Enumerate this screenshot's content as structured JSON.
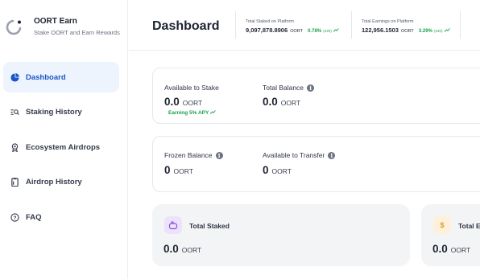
{
  "brand": {
    "name": "OORT Earn",
    "tagline": "Stake OORT and Earn Rewards"
  },
  "sidebar": {
    "items": [
      {
        "label": "Dashboard",
        "icon": "pie-chart-icon",
        "active": true
      },
      {
        "label": "Staking History",
        "icon": "list-search-icon",
        "active": false
      },
      {
        "label": "Ecosystem Airdrops",
        "icon": "medal-icon",
        "active": false
      },
      {
        "label": "Airdrop History",
        "icon": "clipboard-icon",
        "active": false
      },
      {
        "label": "FAQ",
        "icon": "question-circle-icon",
        "active": false
      }
    ]
  },
  "header": {
    "title": "Dashboard",
    "total_staked": {
      "label": "Total Staked on Platform",
      "value": "9,097,878.8906",
      "unit": "OORT",
      "change": "0.78%",
      "period": "(24h)"
    },
    "total_earnings": {
      "label": "Total Earnings on Platform",
      "value": "122,956.1503",
      "unit": "OORT",
      "change": "3.29%",
      "period": "(24h)"
    }
  },
  "cards": {
    "available_to_stake": {
      "label": "Available to Stake",
      "value": "0.0",
      "unit": "OORT",
      "apy": "Earning 5% APY"
    },
    "total_balance": {
      "label": "Total Balance",
      "value": "0.0",
      "unit": "OORT"
    },
    "frozen_balance": {
      "label": "Frozen Balance",
      "value": "0",
      "unit": "OORT"
    },
    "available_to_transfer": {
      "label": "Available to Transfer",
      "value": "0",
      "unit": "OORT"
    },
    "total_staked": {
      "label": "Total Staked",
      "value": "0.0",
      "unit": "OORT"
    },
    "total_earned": {
      "label": "Total E",
      "value": "0.0",
      "unit": "OORT"
    }
  },
  "colors": {
    "accent": "#1a56c8",
    "positive": "#17a34a",
    "active_bg": "#eef4fd"
  }
}
